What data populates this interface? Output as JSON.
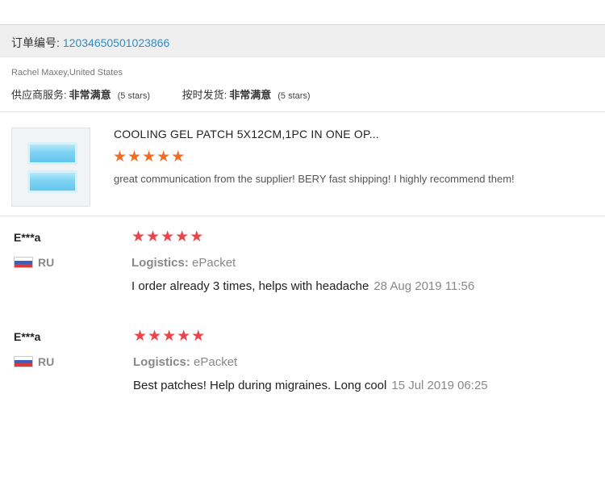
{
  "order": {
    "label": "订单编号:",
    "number": "12034650501023866"
  },
  "buyer": "Rachel Maxey,United States",
  "ratings": [
    {
      "label": "供应商服务:",
      "value": "非常满意",
      "stars": "(5 stars)"
    },
    {
      "label": "按时发货:",
      "value": "非常满意",
      "stars": "(5 stars)"
    }
  ],
  "product": {
    "title": "COOLING GEL PATCH 5X12CM,1PC IN ONE OP...",
    "rating": 5,
    "comment": "great communication from the supplier! BERY fast shipping! I highly recommend them!"
  },
  "reviews": [
    {
      "user": "E***a",
      "country": "RU",
      "rating": 5,
      "logistics_label": "Logistics:",
      "logistics_value": "ePacket",
      "text": "I order already 3 times, helps with headache",
      "date": "28 Aug 2019 11:56"
    },
    {
      "user": "E***a",
      "country": "RU",
      "rating": 5,
      "logistics_label": "Logistics:",
      "logistics_value": "ePacket",
      "text": "Best patches! Help during migraines. Long cool",
      "date": "15 Jul 2019 06:25"
    }
  ],
  "colors": {
    "order_number": "#2d8cc9",
    "product_star": "#f36d21",
    "review_star": "#e8464c"
  },
  "icons": [
    "star-icon",
    "russia-flag-icon",
    "product-image"
  ]
}
